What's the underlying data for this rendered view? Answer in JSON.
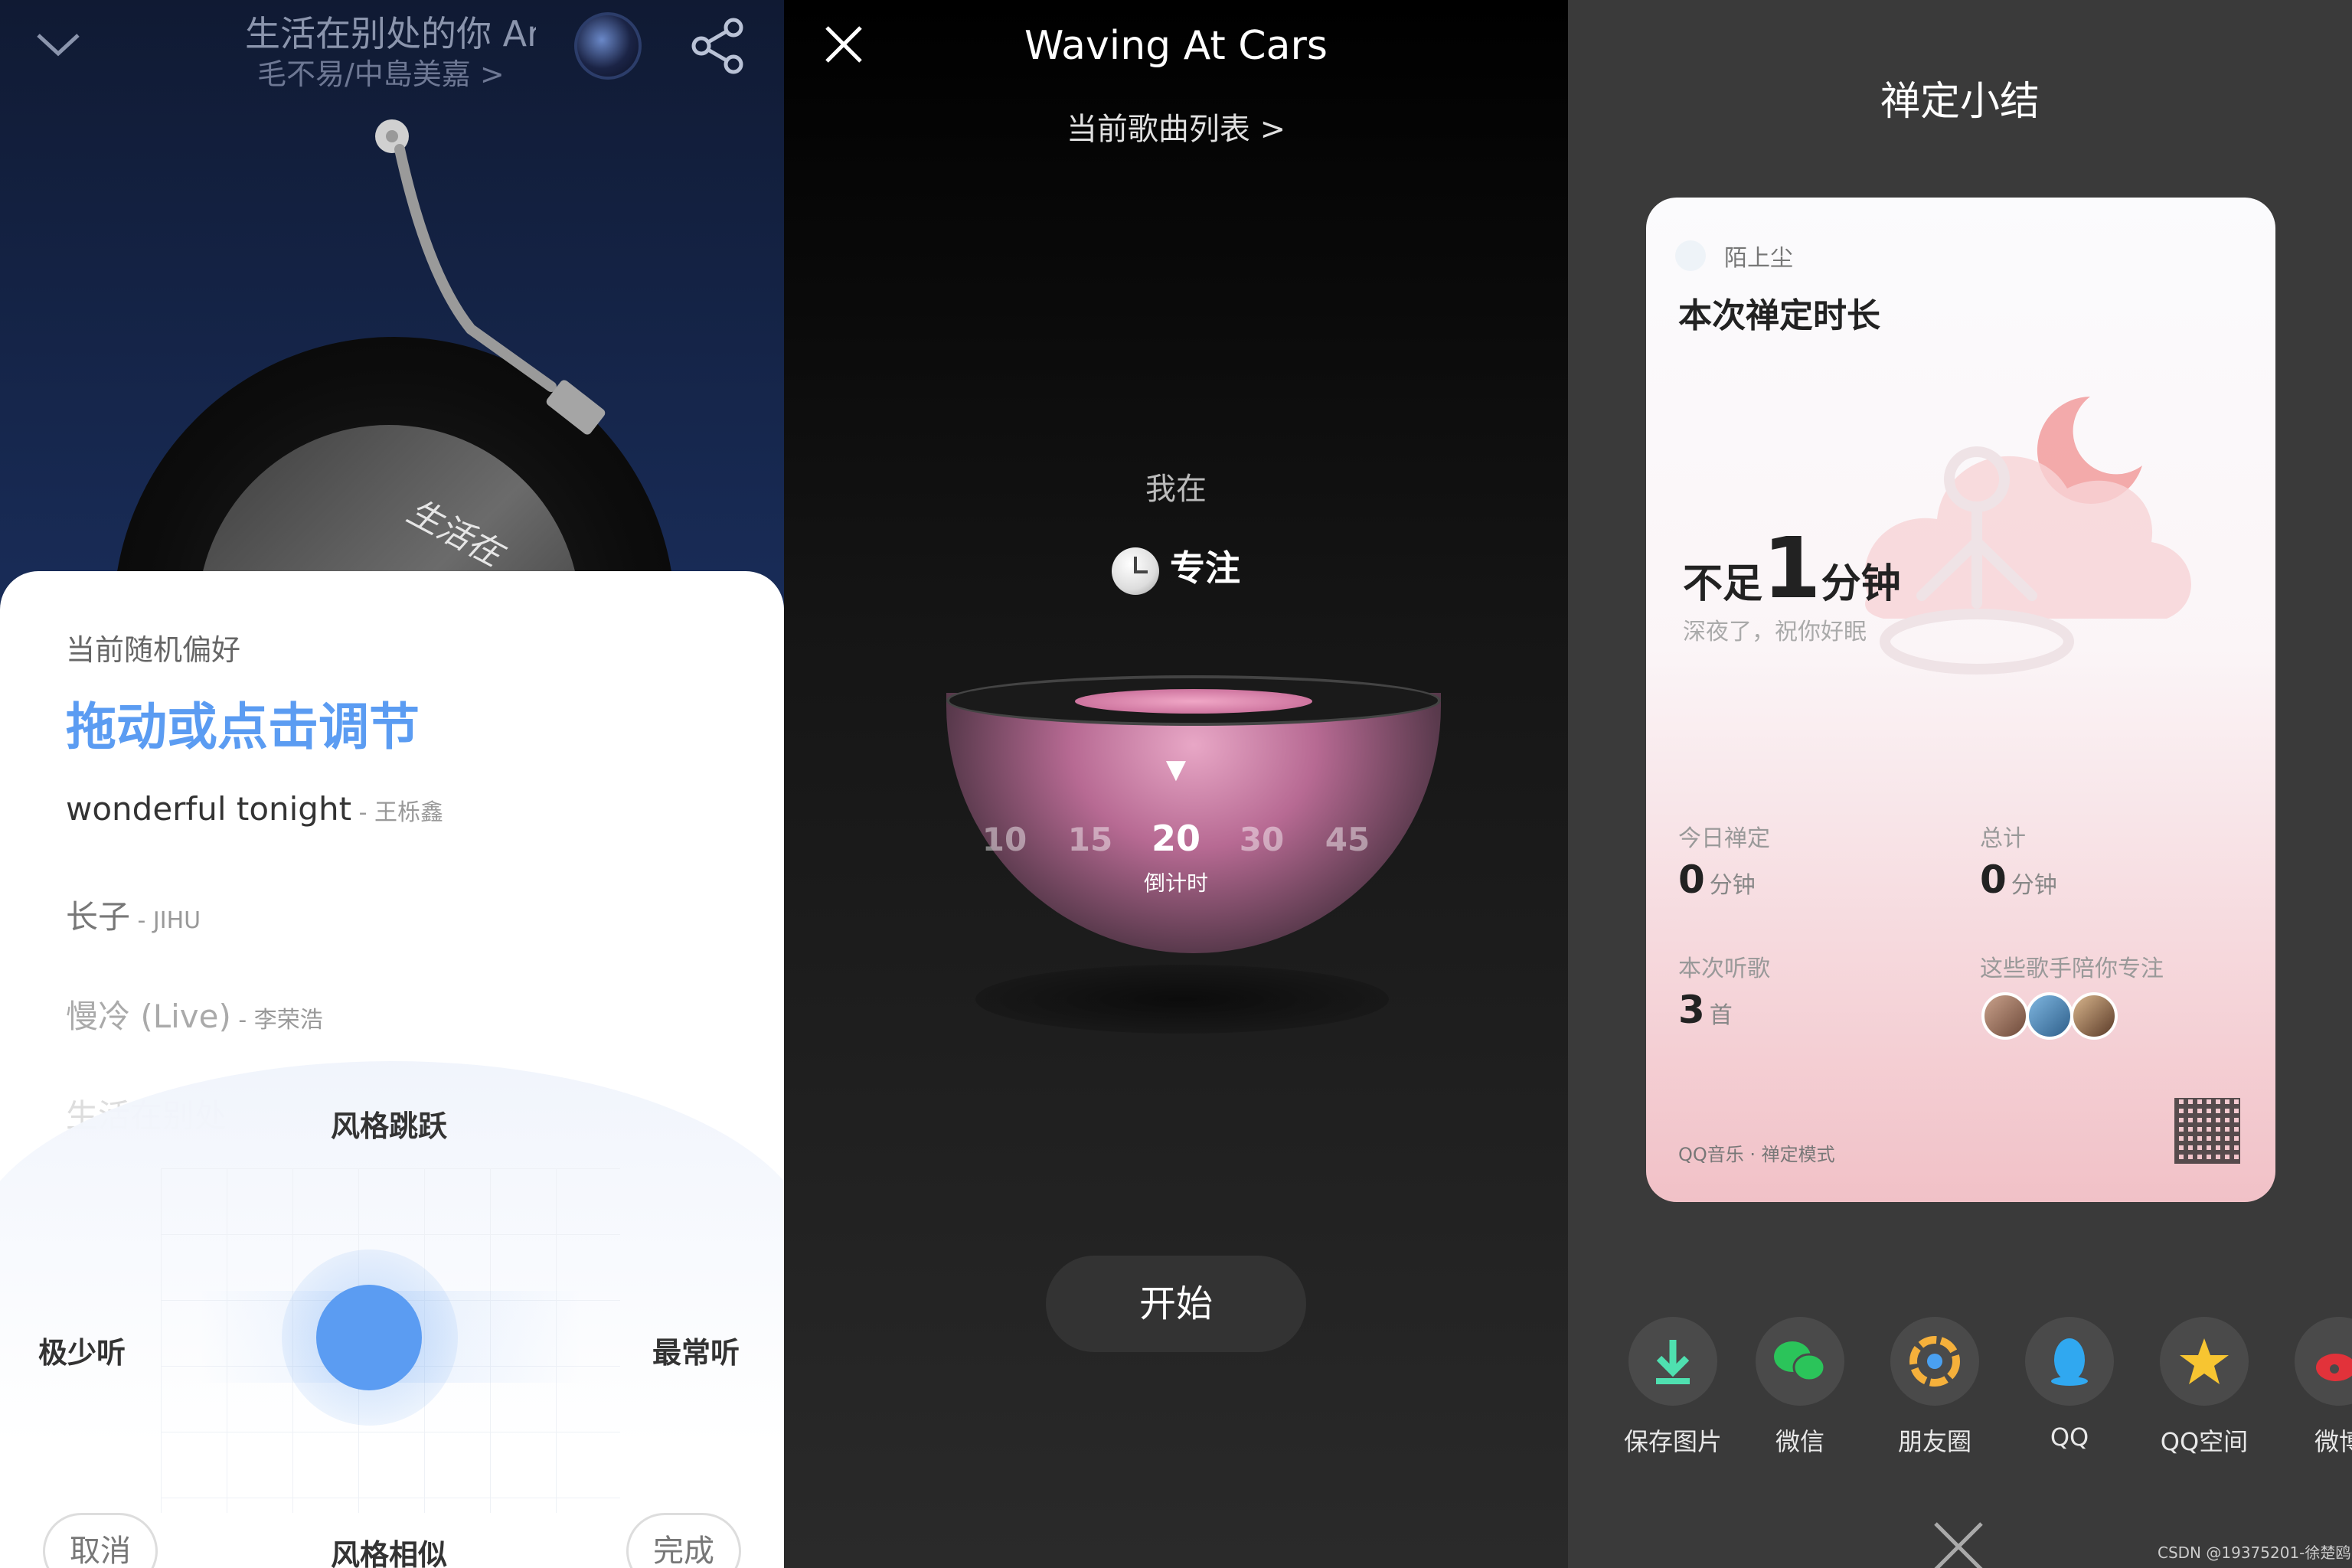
{
  "panel1": {
    "song_title": "生活在别处的你 Ar",
    "artist": "毛不易/中島美嘉 >",
    "vinyl_text": "生活在",
    "preference_subtitle": "当前随机偏好",
    "preference_title": "拖动或点击调节",
    "songs": [
      {
        "title": "wonderful tonight",
        "artist": " - 王栎鑫"
      },
      {
        "title": "长子",
        "artist": " - JIHU"
      },
      {
        "title": "慢冷 (Live)",
        "artist": " - 李荣浩"
      },
      {
        "title": "生活在别处",
        "artist": ""
      }
    ],
    "axis_top": "风格跳跃",
    "axis_bottom": "风格相似",
    "axis_left": "极少听",
    "axis_right": "最常听",
    "cancel_label": "取消",
    "done_label": "完成",
    "accent_color": "#5b9cf2"
  },
  "panel2": {
    "title": "Waving At Cars",
    "playlist_link": "当前歌曲列表 >",
    "im_at": "我在",
    "focus_label": "专注",
    "marker": "▼",
    "ticks": [
      "10",
      "15",
      "20",
      "30",
      "45"
    ],
    "selected_tick": "20",
    "countdown_label": "倒计时",
    "start_label": "开始"
  },
  "panel3": {
    "title": "禅定小结",
    "user_name": "陌上尘",
    "card_title": "本次禅定时长",
    "duration_prefix": "不足",
    "duration_number": "1",
    "duration_suffix": "分钟",
    "duration_subtitle": "深夜了，祝你好眠",
    "stats": {
      "today_label": "今日禅定",
      "today_value": "0",
      "today_unit": "分钟",
      "total_label": "总计",
      "total_value": "0",
      "total_unit": "分钟",
      "songs_label": "本次听歌",
      "songs_value": "3",
      "songs_unit": "首",
      "singers_label": "这些歌手陪你专注"
    },
    "brand": "QQ音乐 · 禅定模式",
    "share_options": [
      {
        "label": "保存图片",
        "icon": "download-icon"
      },
      {
        "label": "微信",
        "icon": "wechat-icon"
      },
      {
        "label": "朋友圈",
        "icon": "moments-icon"
      },
      {
        "label": "QQ",
        "icon": "qq-icon"
      },
      {
        "label": "QQ空间",
        "icon": "qzone-icon"
      },
      {
        "label": "微博",
        "icon": "weibo-icon"
      }
    ],
    "watermark": "CSDN @19375201-徐楚鸥"
  }
}
